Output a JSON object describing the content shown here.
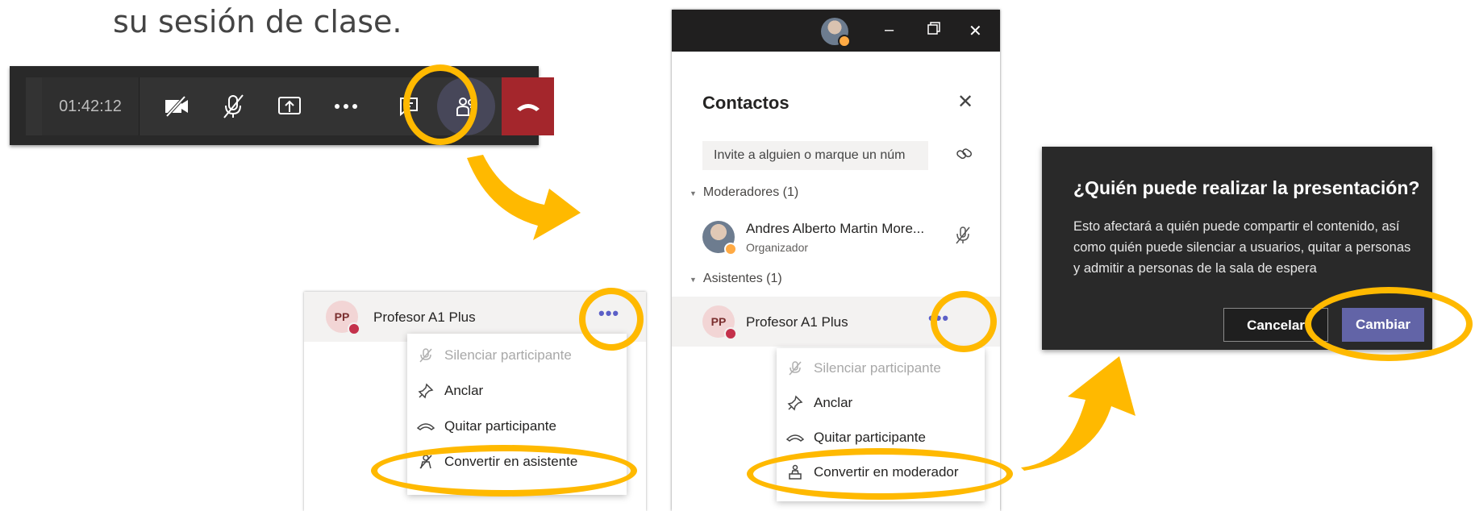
{
  "heading": "su sesión de clase.",
  "toolbar": {
    "timer": "01:42:12",
    "icons": [
      "video-off-icon",
      "mic-off-icon",
      "share-screen-icon",
      "more-icon",
      "chat-icon",
      "participants-icon",
      "hang-up-icon"
    ]
  },
  "panel_small": {
    "participant": {
      "initials": "PP",
      "name": "Profesor A1 Plus"
    },
    "menu": [
      {
        "label": "Silenciar participante",
        "disabled": true
      },
      {
        "label": "Anclar"
      },
      {
        "label": "Quitar participante"
      },
      {
        "label": "Convertir en asistente"
      }
    ]
  },
  "panel_contacts": {
    "title": "Contactos",
    "invite_placeholder": "Invite a alguien o marque un núm",
    "moderators_label": "Moderadores (1)",
    "moderator": {
      "name": "Andres Alberto Martin More...",
      "role": "Organizador"
    },
    "attendees_label": "Asistentes (1)",
    "attendee": {
      "initials": "PP",
      "name": "Profesor A1 Plus"
    },
    "menu": [
      {
        "label": "Silenciar participante",
        "disabled": true
      },
      {
        "label": "Anclar"
      },
      {
        "label": "Quitar participante"
      },
      {
        "label": "Convertir en moderador"
      }
    ]
  },
  "dialog": {
    "title": "¿Quién puede realizar la presentación?",
    "body": "Esto afectará a quién puede compartir el contenido, así como quién puede silenciar a usuarios, quitar a personas y admitir a personas de la sala de espera",
    "cancel_label": "Cancelar",
    "change_label": "Cambiar"
  },
  "colors": {
    "highlight": "#ffb900",
    "accent": "#6264a7",
    "hangup": "#a4262c",
    "presence_busy": "#c4314b",
    "presence_away": "#ffaa44"
  }
}
